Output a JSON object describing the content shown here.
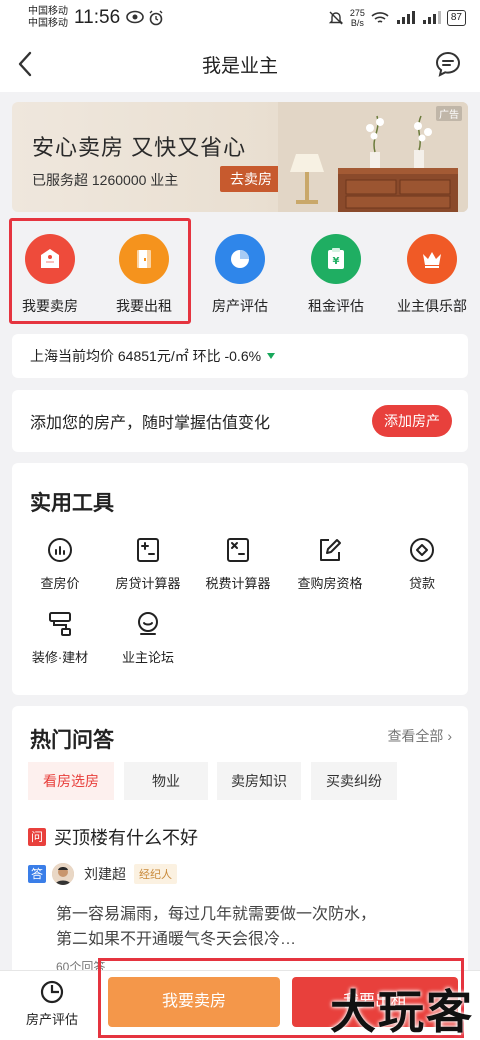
{
  "status_bar": {
    "carrier_1": "中国移动",
    "carrier_2": "中国移动",
    "time": "11:56",
    "speed_value": "275",
    "speed_unit": "B/s",
    "battery": "87"
  },
  "nav": {
    "title": "我是业主"
  },
  "banner": {
    "title": "安心卖房  又快又省心",
    "subtitle": "已服务超 1260000 业主",
    "button": "去卖房",
    "ad_tag": "广告"
  },
  "services": [
    {
      "label": "我要卖房",
      "icon": "house-tag-icon",
      "color": "#ee4b3b"
    },
    {
      "label": "我要出租",
      "icon": "door-icon",
      "color": "#f5931d"
    },
    {
      "label": "房产评估",
      "icon": "pie-chart-icon",
      "color": "#2f86ea"
    },
    {
      "label": "租金评估",
      "icon": "yen-clipboard-icon",
      "color": "#1fae62"
    },
    {
      "label": "业主俱乐部",
      "icon": "crown-icon",
      "color": "#f05a26"
    }
  ],
  "price": {
    "text": "上海当前均价 64851元/㎡ 环比 -0.6%"
  },
  "add_property": {
    "text": "添加您的房产，随时掌握估值变化",
    "button": "添加房产"
  },
  "tools": {
    "title": "实用工具",
    "items": [
      {
        "label": "查房价",
        "icon": "chart-circle-icon"
      },
      {
        "label": "房贷计算器",
        "icon": "calculator-plus-minus-icon"
      },
      {
        "label": "税费计算器",
        "icon": "calculator-multiply-icon"
      },
      {
        "label": "查购房资格",
        "icon": "edit-square-icon"
      },
      {
        "label": "贷款",
        "icon": "diamond-circle-icon"
      },
      {
        "label": "装修·建材",
        "icon": "paint-roller-icon"
      },
      {
        "label": "业主论坛",
        "icon": "forum-person-icon"
      }
    ]
  },
  "qa": {
    "title": "热门问答",
    "see_all": "查看全部",
    "tabs": [
      "看房选房",
      "物业",
      "卖房知识",
      "买卖纠纷"
    ],
    "question_badge": "问",
    "question": "买顶楼有什么不好",
    "answer_badge": "答",
    "answerer": "刘建超",
    "answerer_tag": "经纪人",
    "answer_line_1": "第一容易漏雨，每过几年就需要做一次防水，",
    "answer_line_2": "第二如果不开通暖气冬天会很冷…",
    "answer_count": "60个回答"
  },
  "bottom": {
    "eval_label": "房产评估",
    "sell_button": "我要卖房",
    "rent_button": "我要出租"
  },
  "watermark": "大玩客",
  "colors": {
    "accent_red": "#e8403c",
    "accent_orange": "#f4974a",
    "highlight_box": "#e5343f"
  }
}
